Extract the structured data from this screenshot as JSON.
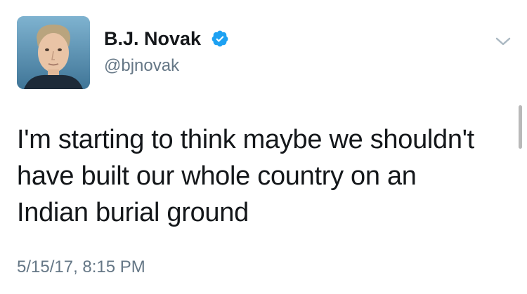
{
  "author": {
    "display_name": "B.J. Novak",
    "handle": "@bjnovak",
    "verified": true,
    "avatar": "profile-photo"
  },
  "tweet": {
    "lines": [
      "I'm starting to think maybe we shouldn't",
      "have built our whole country on an",
      "Indian burial ground"
    ],
    "timestamp": "5/15/17, 8:15 PM"
  },
  "icons": {
    "verified": "verified-badge-icon",
    "menu": "chevron-down-icon"
  },
  "colors": {
    "text": "#14171a",
    "secondary_text": "#657786",
    "verified_blue": "#1da1f2",
    "chevron": "#aab8c2"
  }
}
